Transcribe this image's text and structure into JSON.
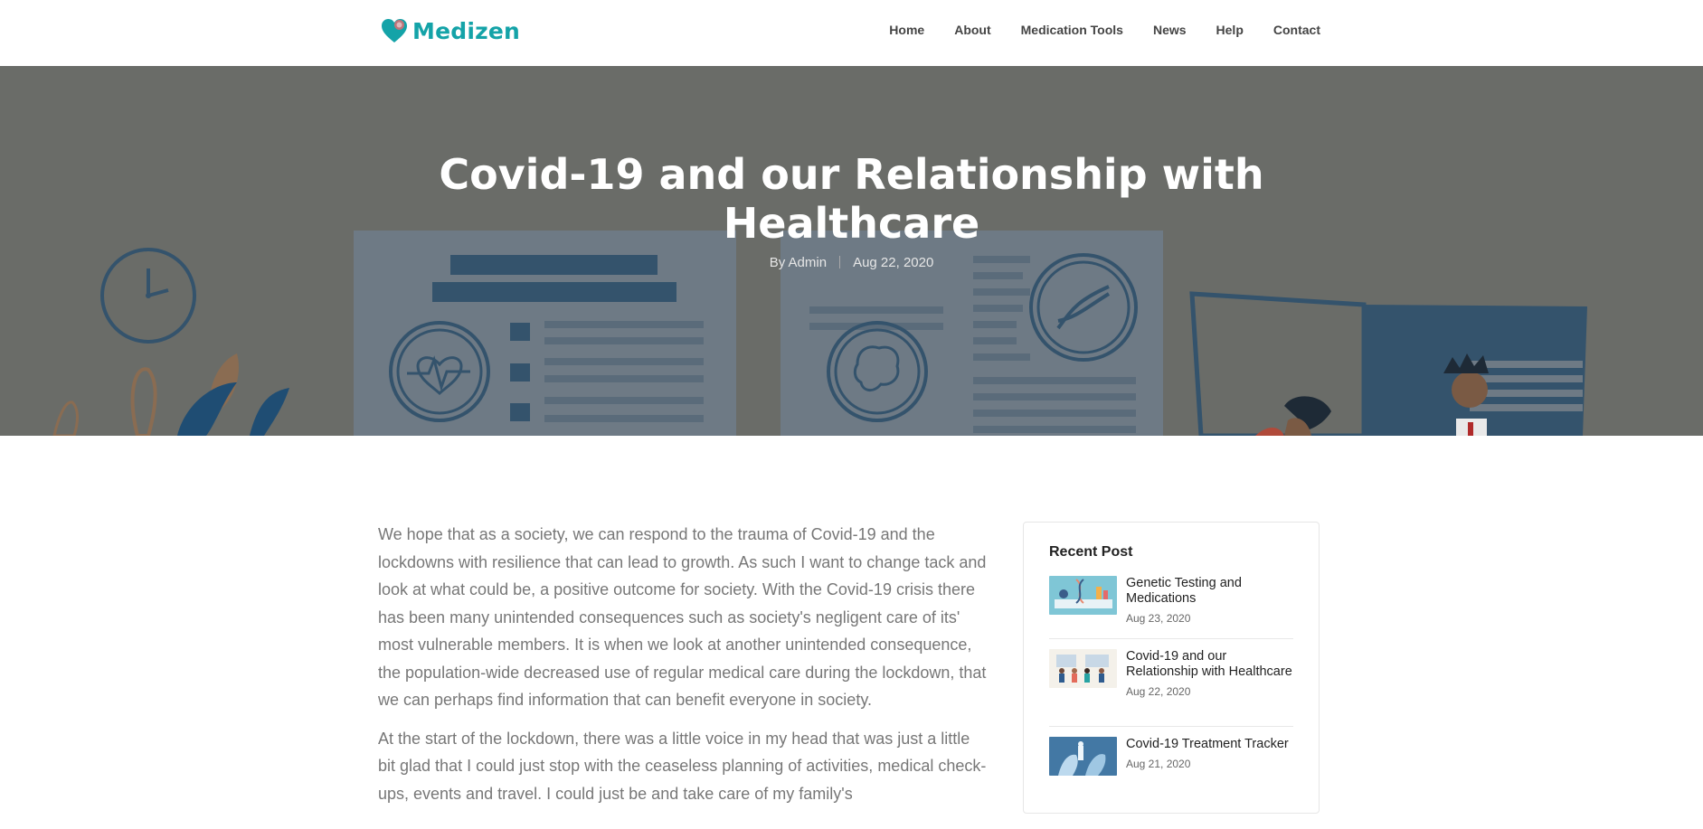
{
  "brand": {
    "name": "Medizen",
    "accent": "#14a3a8"
  },
  "nav": [
    {
      "label": "Home"
    },
    {
      "label": "About"
    },
    {
      "label": "Medication Tools"
    },
    {
      "label": "News"
    },
    {
      "label": "Help"
    },
    {
      "label": "Contact"
    }
  ],
  "hero": {
    "title_line1": "Covid-19 and our Relationship with",
    "title_line2": "Healthcare",
    "author": "By Admin",
    "date": "Aug 22, 2020"
  },
  "article": {
    "paragraphs": [
      "We hope that as a society, we can respond to the trauma of Covid-19 and the lockdowns with resilience that can lead to growth. As such I want to change tack and look at what could be, a positive outcome for society. With the Covid-19 crisis there has been many unintended consequences such as society's negligent care of its' most vulnerable members. It is when we look at another unintended consequence, the population-wide decreased use of regular medical care during the lockdown, that we can perhaps find information that can benefit everyone in society.",
      "At the start of the lockdown, there was a little voice in my head that was just a little bit glad that I could just stop with the ceaseless planning of activities, medical check-ups, events and travel. I could just be and take care of my family's"
    ]
  },
  "sidebar": {
    "heading": "Recent Post",
    "posts": [
      {
        "title": "Genetic Testing and Medications",
        "date": "Aug 23, 2020",
        "thumb_icon": "dna-lab-thumbnail"
      },
      {
        "title": "Covid-19 and our Relationship with Healthcare",
        "date": "Aug 22, 2020",
        "thumb_icon": "people-healthcare-thumbnail"
      },
      {
        "title": "Covid-19 Treatment Tracker",
        "date": "Aug 21, 2020",
        "thumb_icon": "lab-gloves-thumbnail"
      }
    ]
  }
}
